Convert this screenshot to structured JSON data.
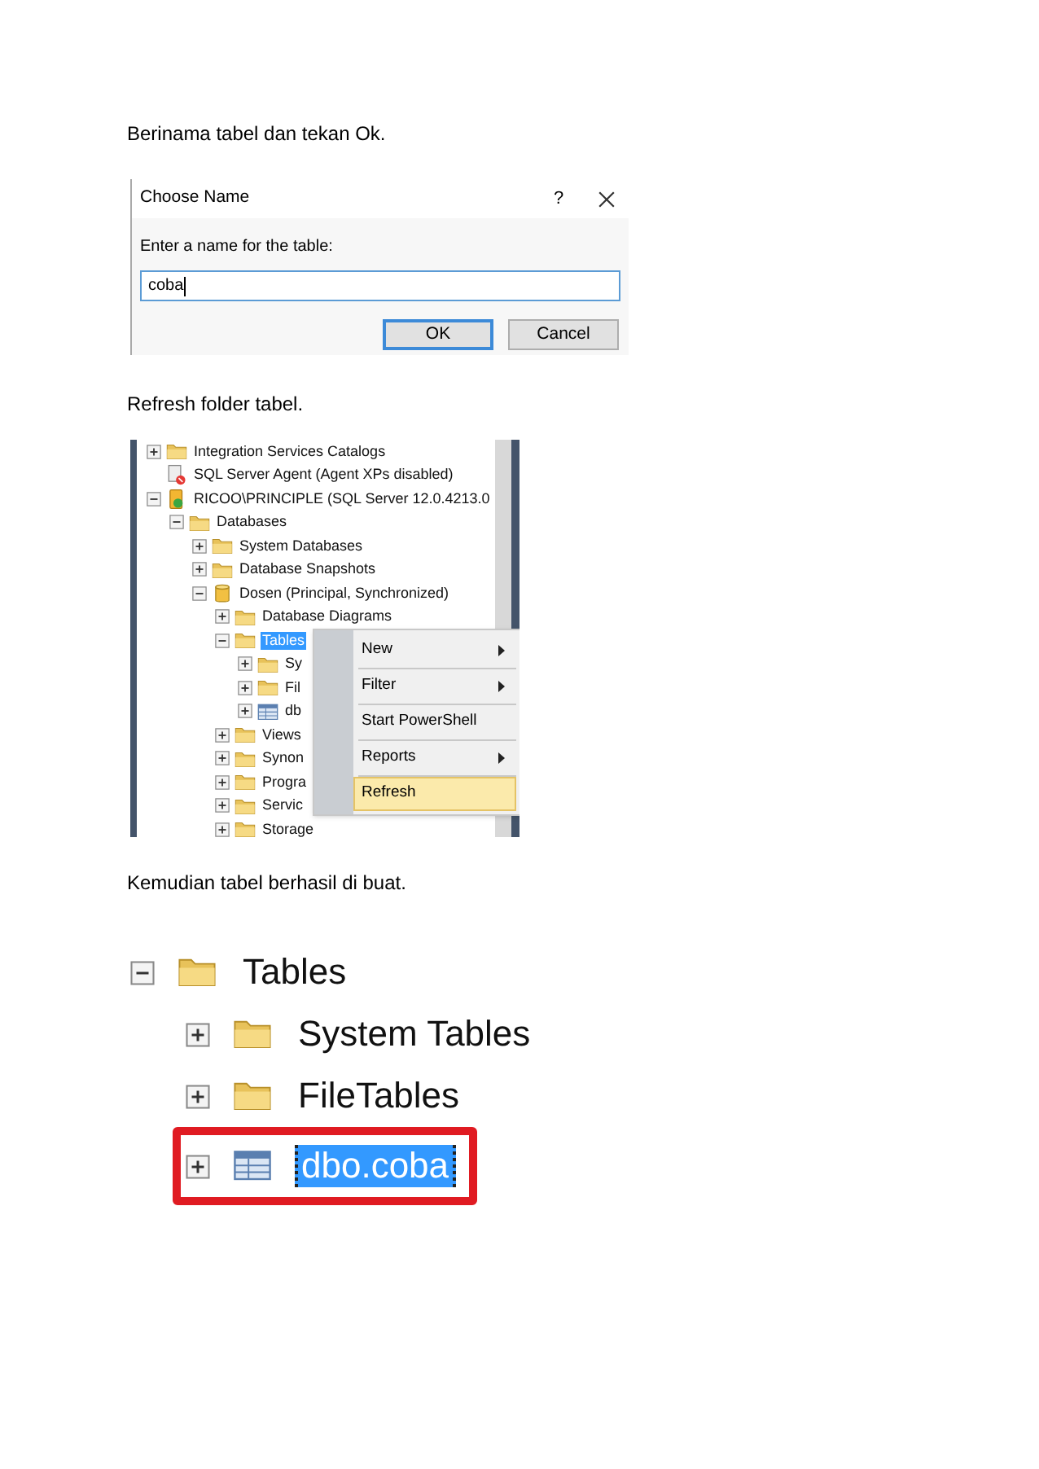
{
  "caption_1": "Berinama tabel dan tekan Ok.",
  "dialog": {
    "title": "Choose Name",
    "help_button": "?",
    "prompt": "Enter a name for the table:",
    "value": "coba",
    "buttons": [
      {
        "label": "OK",
        "default": true
      },
      {
        "label": "Cancel",
        "default": false
      }
    ]
  },
  "caption_2": "Refresh folder tabel.",
  "explorer": {
    "tree": [
      {
        "label": "Integration Services Catalogs",
        "kind": "folder",
        "expanded": false,
        "selected": false
      },
      {
        "label": "SQL Server Agent (Agent XPs disabled)",
        "kind": "agent",
        "selected": false
      },
      {
        "label": "RICOO\\PRINCIPLE (SQL Server 12.0.4213.0",
        "kind": "server",
        "expanded": true,
        "selected": false,
        "children": [
          {
            "label": "Databases",
            "kind": "folder",
            "expanded": true,
            "selected": false,
            "children": [
              {
                "label": "System Databases",
                "kind": "folder",
                "expanded": false,
                "selected": false
              },
              {
                "label": "Database Snapshots",
                "kind": "folder",
                "expanded": false,
                "selected": false
              },
              {
                "label": "Dosen (Principal, Synchronized)",
                "kind": "database",
                "expanded": true,
                "selected": false,
                "children": [
                  {
                    "label": "Database Diagrams",
                    "kind": "folder",
                    "expanded": false,
                    "selected": false
                  },
                  {
                    "label": "Tables",
                    "kind": "folder",
                    "expanded": true,
                    "selected": true,
                    "children": [
                      {
                        "label": "Sy",
                        "kind": "folder",
                        "expanded": false,
                        "selected": false
                      },
                      {
                        "label": "Fil",
                        "kind": "folder",
                        "expanded": false,
                        "selected": false
                      },
                      {
                        "label": "db",
                        "kind": "table",
                        "expanded": false,
                        "selected": false
                      }
                    ]
                  },
                  {
                    "label": "Views",
                    "kind": "folder",
                    "expanded": false,
                    "selected": false
                  },
                  {
                    "label": "Synon",
                    "kind": "folder",
                    "expanded": false,
                    "selected": false
                  },
                  {
                    "label": "Progra",
                    "kind": "folder",
                    "expanded": false,
                    "selected": false
                  },
                  {
                    "label": "Servic",
                    "kind": "folder",
                    "expanded": false,
                    "selected": false
                  },
                  {
                    "label": "Storage",
                    "kind": "folder",
                    "expanded": false,
                    "selected": false
                  }
                ]
              }
            ]
          }
        ]
      }
    ],
    "context_menu": [
      {
        "label": "New",
        "submenu": true,
        "selected": false
      },
      {
        "label": "Filter",
        "submenu": true,
        "selected": false
      },
      {
        "label": "Start PowerShell",
        "submenu": false,
        "selected": false
      },
      {
        "label": "Reports",
        "submenu": true,
        "selected": false
      },
      {
        "label": "Refresh",
        "submenu": false,
        "selected": true
      }
    ]
  },
  "caption_3": "Kemudian tabel berhasil di buat.",
  "zoomed_tree": [
    {
      "label": "Tables",
      "kind": "folder",
      "expanded": true,
      "selected": false,
      "outlined": false,
      "children": [
        {
          "label": "System Tables",
          "kind": "folder",
          "expanded": false,
          "selected": false,
          "outlined": false
        },
        {
          "label": "FileTables",
          "kind": "folder",
          "expanded": false,
          "selected": false,
          "outlined": false
        },
        {
          "label": "dbo.coba",
          "kind": "table",
          "expanded": false,
          "selected": true,
          "outlined": true
        }
      ]
    }
  ]
}
